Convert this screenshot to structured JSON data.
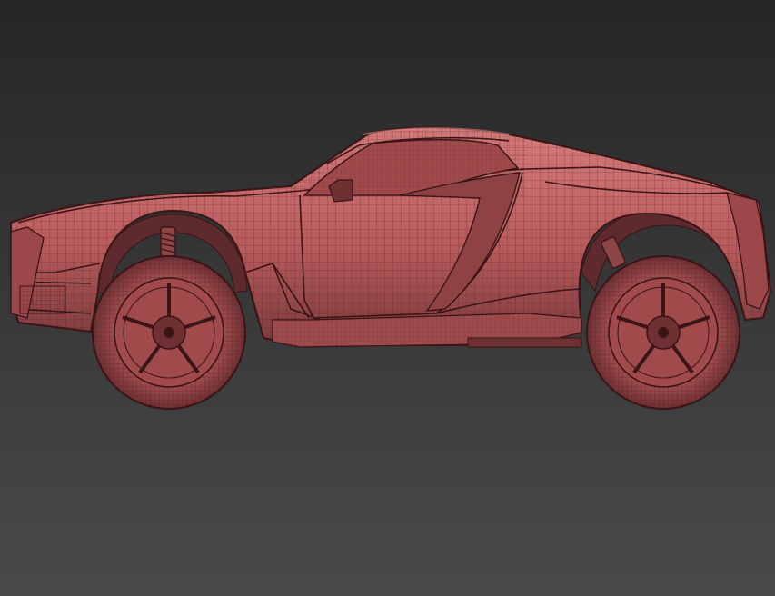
{
  "viewport": {
    "background_top": "#262626",
    "background_bottom": "#4a4a4a"
  },
  "model": {
    "display_mode": "wireframe-over-shaded",
    "shade_color": "#b75a5b",
    "shade_dark": "#7a3a3c",
    "shade_light": "#d67b7b",
    "wire_color": "#4a1c1f",
    "subject_icon": "sports-car-model-icon"
  }
}
